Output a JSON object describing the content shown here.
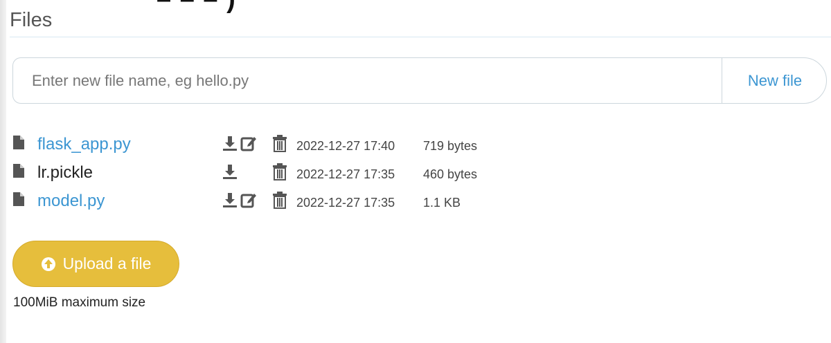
{
  "top_cut_text": "– – – )",
  "section_title": "Files",
  "new_file": {
    "placeholder": "Enter new file name, eg hello.py",
    "value": "",
    "button_label": "New file"
  },
  "files": [
    {
      "name": "flask_app.py",
      "linked": true,
      "editable": true,
      "date": "2022-12-27 17:40",
      "size": "719 bytes"
    },
    {
      "name": "lr.pickle",
      "linked": false,
      "editable": false,
      "date": "2022-12-27 17:35",
      "size": "460 bytes"
    },
    {
      "name": "model.py",
      "linked": true,
      "editable": true,
      "date": "2022-12-27 17:35",
      "size": "1.1 KB"
    }
  ],
  "upload": {
    "button_label": "Upload a file",
    "max_size_note": "100MiB maximum size"
  },
  "colors": {
    "link": "#3c96d2",
    "upload_button": "#e6be3c",
    "icon_gray": "#555555"
  },
  "icons": {
    "file": "file-icon",
    "download": "download-icon",
    "edit": "edit-icon",
    "delete": "trash-icon",
    "upload": "circle-arrow-up-icon"
  }
}
